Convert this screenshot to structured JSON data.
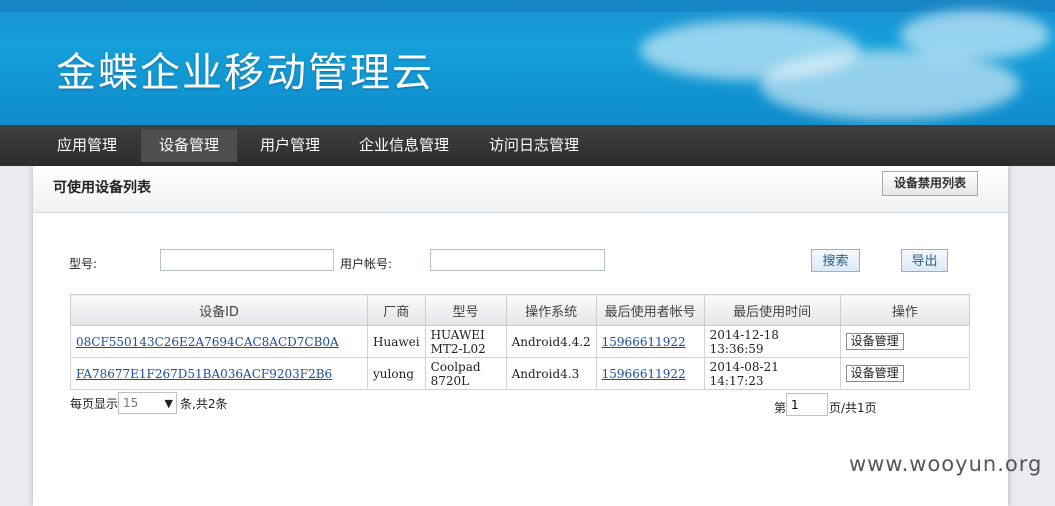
{
  "app": {
    "title": "金蝶企业移动管理云"
  },
  "nav": {
    "items": [
      {
        "label": "应用管理"
      },
      {
        "label": "设备管理",
        "active": true
      },
      {
        "label": "用户管理"
      },
      {
        "label": "企业信息管理"
      },
      {
        "label": "访问日志管理"
      }
    ]
  },
  "panel": {
    "title": "可使用设备列表",
    "disabled_list_button": "设备禁用列表"
  },
  "search": {
    "model_label": "型号:",
    "model_value": "",
    "account_label": "用户帐号:",
    "account_value": "",
    "search_button": "搜索",
    "export_button": "导出"
  },
  "table": {
    "headers": [
      "设备ID",
      "厂商",
      "型号",
      "操作系统",
      "最后使用者帐号",
      "最后使用时间",
      "操作"
    ],
    "rows": [
      {
        "device_id": "08CF550143C26E2A7694CAC8ACD7CB0A",
        "vendor": "Huawei",
        "model": "HUAWEI MT2-L02",
        "os": "Android4.4.2",
        "account": "15966611922",
        "last_time": "2014-12-18 13:36:59",
        "action": "设备管理"
      },
      {
        "device_id": "FA78677E1F267D51BA036ACF9203F2B6",
        "vendor": "yulong",
        "model": "Coolpad 8720L",
        "os": "Android4.3",
        "account": "15966611922",
        "last_time": "2014-08-21 14:17:23",
        "action": "设备管理"
      }
    ]
  },
  "pager": {
    "per_page_label": "每页显示",
    "per_page_value": "15",
    "total_text": "条,共2条",
    "page_prefix": "第",
    "page_value": "1",
    "page_suffix": "页/共1页"
  },
  "watermark": "www.wooyun.org"
}
